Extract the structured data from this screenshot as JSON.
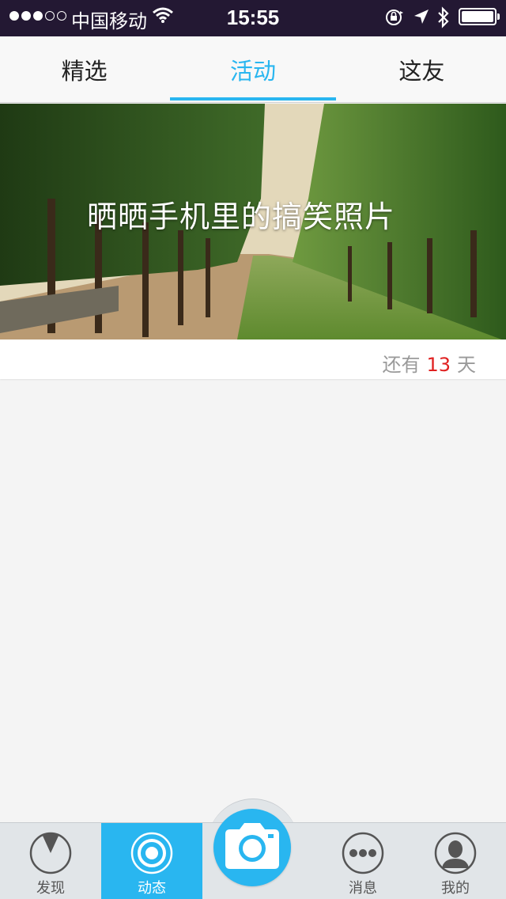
{
  "status_bar": {
    "carrier": "中国移动",
    "time": "15:55",
    "signal_bars_filled": 3,
    "signal_bars_total": 5,
    "battery_level": 1.0
  },
  "top_tabs": [
    {
      "label": "精选",
      "active": false
    },
    {
      "label": "活动",
      "active": true
    },
    {
      "label": "这友",
      "active": false
    }
  ],
  "activity": {
    "title": "晒晒手机里的搞笑照片",
    "countdown_prefix": "还有",
    "days_left": "13",
    "countdown_suffix": "天"
  },
  "bottom_nav": {
    "discover_label": "发现",
    "feed_label": "动态",
    "messages_label": "消息",
    "me_label": "我的",
    "active": "动态"
  },
  "colors": {
    "accent": "#29b6f0",
    "countdown_number": "#e02020",
    "status_bar_bg": "#231833"
  }
}
